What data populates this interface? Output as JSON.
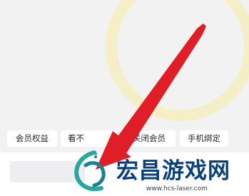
{
  "tabs": [
    {
      "label": "会员权益"
    },
    {
      "label": "看不"
    },
    {
      "label": "关闭会员"
    },
    {
      "label": "手机绑定"
    }
  ],
  "watermark": {
    "brand": "宏昌游戏网",
    "url": "www.hcs-laser.com"
  },
  "colors": {
    "arrow": "#e01e27",
    "ring": "#f4efc7",
    "brand": "#0b3f78",
    "logo_teal": "#2aa6a0"
  },
  "icons": [
    "red-arrow-annotation",
    "dragon-logo-icon"
  ]
}
